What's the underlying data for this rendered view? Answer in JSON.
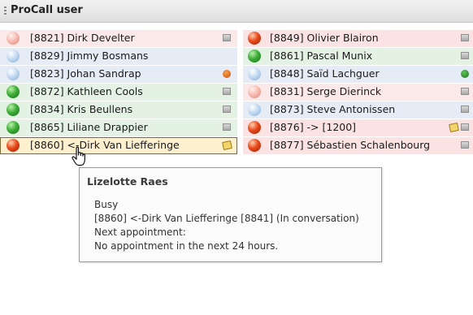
{
  "panel": {
    "title": "ProCall user"
  },
  "contacts_left": [
    {
      "label": "[8821] Dirk Develter",
      "ball": "pink",
      "row": "away",
      "status_icon": "contact-card"
    },
    {
      "label": "[8829] Jimmy Bosmans",
      "ball": "blue",
      "row": "offline",
      "status_icon": ""
    },
    {
      "label": "[8823] Johan Sandrap",
      "ball": "blue",
      "row": "offline",
      "status_icon": "orange-tag"
    },
    {
      "label": "[8872] Kathleen Cools",
      "ball": "green",
      "row": "avail",
      "status_icon": "contact-card"
    },
    {
      "label": "[8834] Kris Beullens",
      "ball": "green",
      "row": "avail",
      "status_icon": "contact-card"
    },
    {
      "label": "[8865] Liliane Drappier",
      "ball": "green",
      "row": "avail",
      "status_icon": "contact-card"
    },
    {
      "label": "[8860] <-Dirk Van Liefferinge",
      "ball": "red",
      "row": "selected",
      "status_icon": "note"
    }
  ],
  "contacts_right": [
    {
      "label": "[8849] Olivier Blairon",
      "ball": "red",
      "row": "busy",
      "status_icon": "contact-card"
    },
    {
      "label": "[8861] Pascal Munix",
      "ball": "green",
      "row": "avail",
      "status_icon": "contact-card"
    },
    {
      "label": "[8848] Saïd Lachguer",
      "ball": "blue",
      "row": "offline",
      "status_icon": "green-tag"
    },
    {
      "label": "[8831] Serge Dierinck",
      "ball": "pink",
      "row": "away",
      "status_icon": "contact-card"
    },
    {
      "label": "[8873] Steve Antonissen",
      "ball": "blue",
      "row": "offline",
      "status_icon": "contact-card"
    },
    {
      "label": "[8876] -> [1200]",
      "ball": "red",
      "row": "busy",
      "status_icon": "note+contact-card"
    },
    {
      "label": "[8877] Sébastien Schalenbourg",
      "ball": "red",
      "row": "busy",
      "status_icon": "contact-card"
    }
  ],
  "tooltip": {
    "name": "Lizelotte Raes",
    "lines": [
      "Busy",
      "[8860] <-Dirk Van Liefferinge [8841] (In conversation)",
      "Next appointment:",
      "No appointment in the next 24 hours."
    ]
  },
  "colors": {
    "available": "#3fae3a",
    "busy": "#e84a1c",
    "away": "#f4b2a6",
    "offline": "#b9d3ee"
  }
}
